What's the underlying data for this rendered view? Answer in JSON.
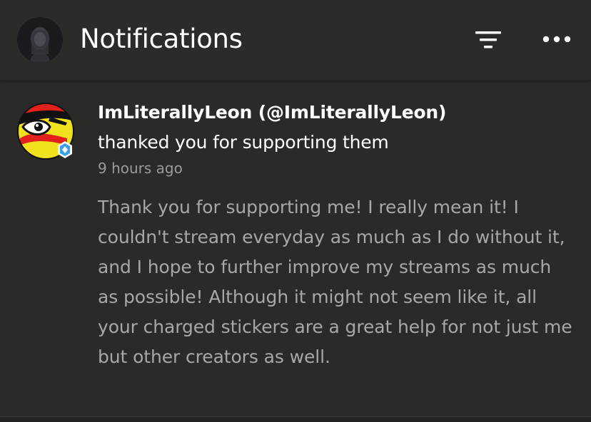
{
  "header": {
    "title": "Notifications",
    "filter_icon": "filter-icon",
    "more_icon": "more-horizontal-icon"
  },
  "notification": {
    "sender": "ImLiterallyLeon (@ImLiterallyLeon)",
    "action": "thanked you for supporting them",
    "time": "9 hours ago",
    "message": "Thank you for supporting me! I really mean it! I couldn't stream everyday as much as I do without it, and I hope to further improve my streams as much as possible! Although it might not seem like it, all your charged stickers are a great help for not just me but other creators as well."
  },
  "colors": {
    "background": "#2a2a28",
    "title": "#ffffff",
    "message": "#a7a7a5",
    "timestamp": "#9a9a98",
    "badge": "#3aa0e8"
  }
}
